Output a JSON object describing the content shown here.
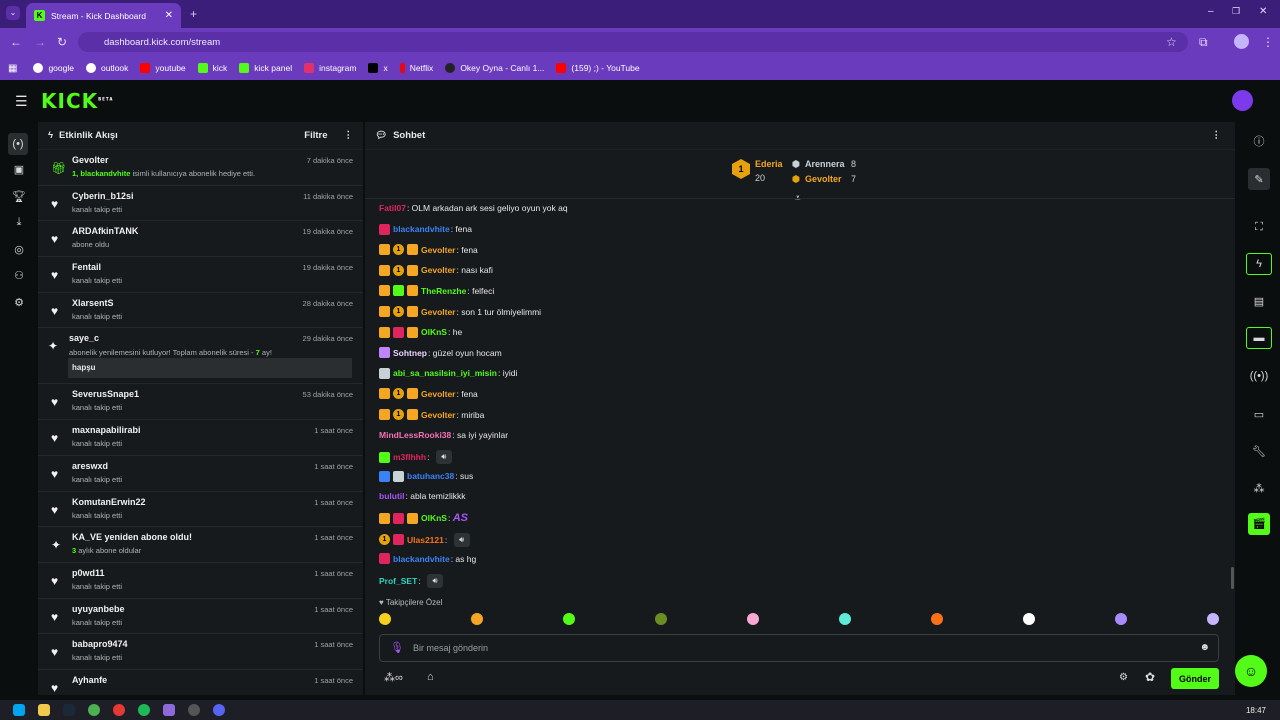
{
  "browser": {
    "tab_title": "Stream - Kick Dashboard",
    "url": "dashboard.kick.com/stream",
    "bookmarks": [
      "google",
      "outlook",
      "youtube",
      "kick",
      "kick panel",
      "instagram",
      "x",
      "Netflix",
      "Okey Oyna - Canlı 1...",
      "(159) ;) - YouTube"
    ]
  },
  "header": {
    "logo": "KICK",
    "beta": "BETA"
  },
  "activity": {
    "title": "Etkinlik Akışı",
    "filter": "Filtre",
    "events": [
      {
        "name": "Gevolter",
        "sub": "isimli kullanıcıya abonelik hediye etti.",
        "sub_prefix_num": "1,",
        "sub_prefix_user": "blackandvhite",
        "time": "7 dakika önce",
        "icon": "gift"
      },
      {
        "name": "Cyberin_b12si",
        "sub": "kanalı takip etti",
        "time": "11 dakika önce",
        "icon": "heart"
      },
      {
        "name": "ARDAfkinTANK",
        "sub": "abone oldu",
        "time": "19 dakika önce",
        "icon": "heart"
      },
      {
        "name": "Fentail",
        "sub": "kanalı takip etti",
        "time": "19 dakika önce",
        "icon": "heart"
      },
      {
        "name": "XlarsentS",
        "sub": "kanalı takip etti",
        "time": "28 dakika önce",
        "icon": "heart"
      },
      {
        "name": "saye_c",
        "sub": "abonelik yenilemesini kutluyor! Toplam abonelik süresi -",
        "sub_num": "7",
        "sub_tail": "ay!",
        "quote": "hapşu",
        "time": "29 dakika önce",
        "icon": "star"
      },
      {
        "name": "SeverusSnape1",
        "sub": "kanalı takip etti",
        "time": "53 dakika önce",
        "icon": "heart"
      },
      {
        "name": "maxnapabilirabi",
        "sub": "kanalı takip etti",
        "time": "1 saat önce",
        "icon": "heart"
      },
      {
        "name": "areswxd",
        "sub": "kanalı takip etti",
        "time": "1 saat önce",
        "icon": "heart"
      },
      {
        "name": "KomutanErwin22",
        "sub": "kanalı takip etti",
        "time": "1 saat önce",
        "icon": "heart"
      },
      {
        "name": "KA_VE yeniden abone oldu!",
        "sub": "aylık abone oldular",
        "sub_num": "3",
        "time": "1 saat önce",
        "icon": "star"
      },
      {
        "name": "p0wd11",
        "sub": "kanalı takip etti",
        "time": "1 saat önce",
        "icon": "heart"
      },
      {
        "name": "uyuyanbebe",
        "sub": "kanalı takip etti",
        "time": "1 saat önce",
        "icon": "heart"
      },
      {
        "name": "babapro9474",
        "sub": "kanalı takip etti",
        "time": "1 saat önce",
        "icon": "heart"
      },
      {
        "name": "Ayhanfe",
        "sub": "",
        "time": "1 saat önce",
        "icon": "heart"
      }
    ]
  },
  "chat": {
    "title": "Sohbet",
    "leaders": [
      {
        "name": "Ederia",
        "count": "20"
      },
      {
        "name": "Arennera",
        "count": "8"
      },
      {
        "name": "Gevolter",
        "count": "7"
      }
    ],
    "messages": [
      {
        "user": "Fatil07",
        "color": "#e0245e",
        "text": "OLM arkadan ark sesi geliyo oyun yok aq",
        "badges": []
      },
      {
        "user": "blackandvhite",
        "color": "#3b82f6",
        "text": "fena",
        "badges": [
          "red"
        ]
      },
      {
        "user": "Gevolter",
        "color": "#f5a623",
        "text": "fena",
        "badges": [
          "crown",
          "num",
          "gift"
        ]
      },
      {
        "user": "Gevolter",
        "color": "#f5a623",
        "text": "nası kafi",
        "badges": [
          "crown",
          "num",
          "gift"
        ]
      },
      {
        "user": "TheRenzhe",
        "color": "#53fc18",
        "text": "felfeci",
        "badges": [
          "crown",
          "green",
          "gift"
        ]
      },
      {
        "user": "Gevolter",
        "color": "#f5a623",
        "text": "son 1 tur ölmiyelimmi",
        "badges": [
          "crown",
          "num",
          "gift"
        ]
      },
      {
        "user": "OlKnS",
        "color": "#53fc18",
        "text": "he",
        "badges": [
          "crown",
          "red",
          "gift"
        ]
      },
      {
        "user": "Sohtnep",
        "color": "#e9d5ff",
        "text": "güzel oyun hocam",
        "badges": [
          "purple"
        ]
      },
      {
        "user": "abi_sa_nasilsin_iyi_misin",
        "color": "#53fc18",
        "text": "iyidi",
        "badges": [
          "silver"
        ]
      },
      {
        "user": "Gevolter",
        "color": "#f5a623",
        "text": "fena",
        "badges": [
          "crown",
          "num",
          "gift"
        ]
      },
      {
        "user": "Gevolter",
        "color": "#f5a623",
        "text": "miriba",
        "badges": [
          "crown",
          "num",
          "gift"
        ]
      },
      {
        "user": "MindLessRooki38",
        "color": "#f472b6",
        "text": "sa iyi yayinlar",
        "badges": []
      },
      {
        "user": "m3fIhhh",
        "color": "#e0245e",
        "text": "",
        "badges": [
          "green"
        ],
        "sound": true
      },
      {
        "user": "batuhanc38",
        "color": "#3b82f6",
        "text": "sus",
        "badges": [
          "blue",
          "silver"
        ]
      },
      {
        "user": "bulutil",
        "color": "#a855f7",
        "text": "abla temizlikkk",
        "badges": []
      },
      {
        "user": "OlKnS",
        "color": "#53fc18",
        "text": "",
        "emote": "AS",
        "badges": [
          "crown",
          "red",
          "gift"
        ]
      },
      {
        "user": "Ulas2121",
        "color": "#f97316",
        "text": "",
        "badges": [
          "num",
          "red"
        ],
        "sound": true
      },
      {
        "user": "blackandvhite",
        "color": "#3b82f6",
        "text": "as hg",
        "badges": [
          "red"
        ]
      },
      {
        "user": "Prof_SET",
        "color": "#2dd4bf",
        "text": "",
        "badges": [],
        "sound": true
      }
    ],
    "followers_only": "Takipçilere Özel",
    "input_placeholder": "Bir mesaj gönderin",
    "send": "Gönder"
  },
  "taskbar": {
    "time": "18:47"
  }
}
